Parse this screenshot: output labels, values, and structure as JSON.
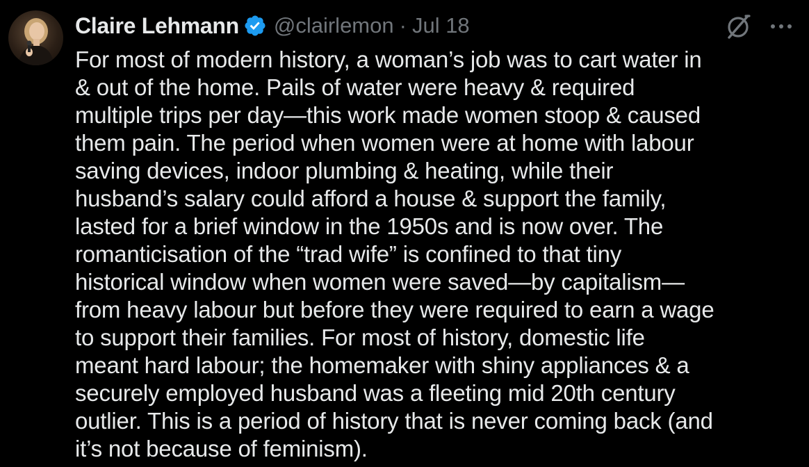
{
  "tweet": {
    "author": {
      "name": "Claire Lehmann",
      "handle": "@clairlemon",
      "separator": "·",
      "date": "Jul 18",
      "verified": true,
      "verified_color": "#1d9bf0"
    },
    "icons": {
      "grok": "grok-icon",
      "more": "more-icon",
      "verified": "verified-badge-icon"
    },
    "text_lines": [
      "For most of modern history, a woman’s job was to cart water in",
      "& out of the home. Pails of water were heavy & required",
      "multiple trips per day—this work made women stoop & caused",
      "them pain. The period when women were at home with labour",
      "saving devices, indoor plumbing & heating, while their",
      "husband’s salary could afford a house & support the family,",
      "lasted for a brief window in the 1950s and is now over. The",
      "romanticisation of the “trad wife” is confined to that tiny",
      "historical window when women were saved—by capitalism—",
      "from heavy labour but before they were required to earn a wage",
      "to support their families. For most of history, domestic life",
      "meant hard labour; the homemaker with shiny appliances & a",
      "securely employed husband was a fleeting mid 20th century",
      "outlier. This is a period of history that is never coming back (and",
      "it’s not because of feminism)."
    ]
  },
  "colors": {
    "background": "#000000",
    "primary_text": "#e7e9ea",
    "secondary_text": "#71767b",
    "accent": "#1d9bf0"
  }
}
